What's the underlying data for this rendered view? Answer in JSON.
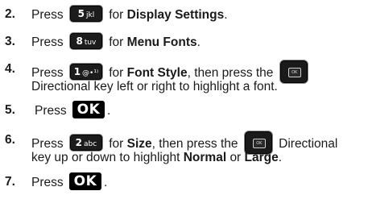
{
  "steps": [
    {
      "number": "2.",
      "press": "Press",
      "key": {
        "digit": "5",
        "letters": "jkl",
        "icon": "key-5-jkl"
      },
      "for": "for",
      "target": "Display Settings",
      "end": "."
    },
    {
      "number": "3.",
      "press": "Press",
      "key": {
        "digit": "8",
        "letters": "tuv",
        "icon": "key-8-tuv"
      },
      "for": "for",
      "target": "Menu Fonts",
      "end": "."
    },
    {
      "number": "4.",
      "press": "Press",
      "key": {
        "digit": "1",
        "letters": "@ voicemail",
        "glyph": "@•¹⁾",
        "icon": "key-1-voicemail"
      },
      "for": "for",
      "target": "Font Style",
      "mid": ", then press the",
      "nav_key": {
        "label": "OK",
        "icon": "directional-key"
      },
      "line2": "Directional key left or right to highlight a font."
    },
    {
      "number": "5.",
      "press": "Press",
      "ok_key": {
        "label": "OK",
        "icon": "ok-key"
      },
      "end": "."
    },
    {
      "number": "6.",
      "press": "Press",
      "key": {
        "digit": "2",
        "letters": "abc",
        "icon": "key-2-abc"
      },
      "for": "for",
      "target": "Size",
      "mid": ", then press the",
      "nav_key": {
        "label": "OK",
        "icon": "directional-key"
      },
      "after_nav": "Directional",
      "line2_pre": "key up or down to highlight",
      "line2_normal": "Normal",
      "line2_or": "or",
      "line2_large": "Large",
      "line2_end": "."
    },
    {
      "number": "7.",
      "press": "Press",
      "ok_key": {
        "label": "OK",
        "icon": "ok-key"
      },
      "end": "."
    }
  ]
}
